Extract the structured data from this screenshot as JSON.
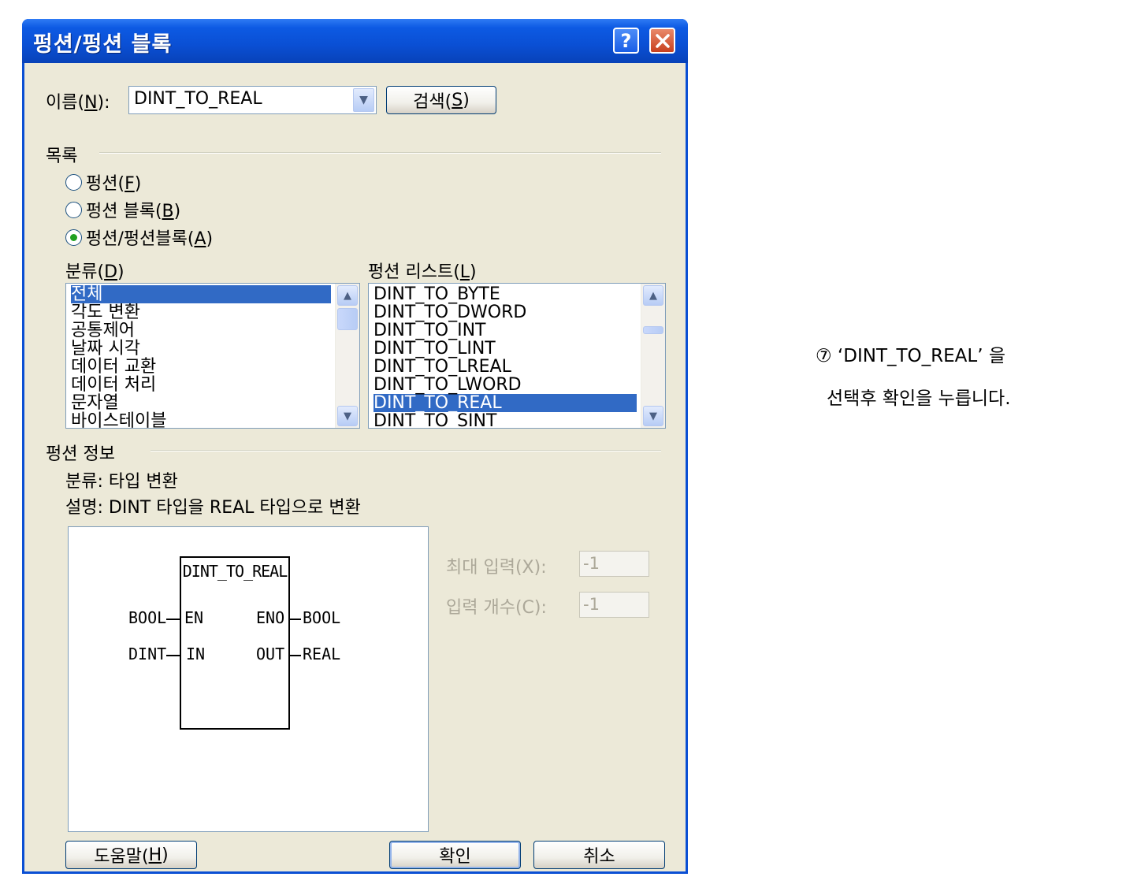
{
  "dialog": {
    "title": "펑션/펑션 블록",
    "help_button": "?",
    "close_button": "✕",
    "name_label_prefix": "이름(",
    "name_label_key": "N",
    "name_label_suffix": "):",
    "name_value": "DINT_TO_REAL",
    "search_prefix": "검색(",
    "search_key": "S",
    "search_suffix": ")",
    "list_group": "목록",
    "radios": [
      {
        "prefix": "펑션(",
        "key": "F",
        "suffix": ")",
        "checked": false
      },
      {
        "prefix": "펑션 블록(",
        "key": "B",
        "suffix": ")",
        "checked": false
      },
      {
        "prefix": "펑션/펑션블록(",
        "key": "A",
        "suffix": ")",
        "checked": true
      }
    ],
    "category_label_prefix": "분류(",
    "category_label_key": "D",
    "category_label_suffix": ")",
    "categories": [
      "전체",
      "각도 변환",
      "공통제어",
      "날짜 시각",
      "데이터 교환",
      "데이터 처리",
      "문자열",
      "바이스테이블"
    ],
    "category_selected": 0,
    "function_list_label_prefix": "펑션 리스트(",
    "function_list_label_key": "L",
    "function_list_label_suffix": ")",
    "functions": [
      "DINT_TO_BYTE",
      "DINT_TO_DWORD",
      "DINT_TO_INT",
      "DINT_TO_LINT",
      "DINT_TO_LREAL",
      "DINT_TO_LWORD",
      "DINT_TO_REAL",
      "DINT_TO_SINT"
    ],
    "function_selected": 6,
    "info_group": "펑션 정보",
    "info_category": "분류: 타입 변환",
    "info_description": "설명: DINT 타입을 REAL 타입으로 변환",
    "block": {
      "name": "DINT_TO_REAL",
      "inputs": [
        {
          "type": "BOOL",
          "pin": "EN"
        },
        {
          "type": "DINT",
          "pin": "IN"
        }
      ],
      "outputs": [
        {
          "pin": "ENO",
          "type": "BOOL"
        },
        {
          "pin": "OUT",
          "type": "REAL"
        }
      ]
    },
    "max_input_label": "최대 입력(X):",
    "max_input_value": "-1",
    "input_count_label": "입력 개수(C):",
    "input_count_value": "-1",
    "help_btn_prefix": "도움말(",
    "help_btn_key": "H",
    "help_btn_suffix": ")",
    "ok_button": "확인",
    "cancel_button": "취소"
  },
  "annotation": {
    "line1": "⑦ ‘DINT_TO_REAL’ 을",
    "line2": "선택후 확인을 누릅니다."
  }
}
